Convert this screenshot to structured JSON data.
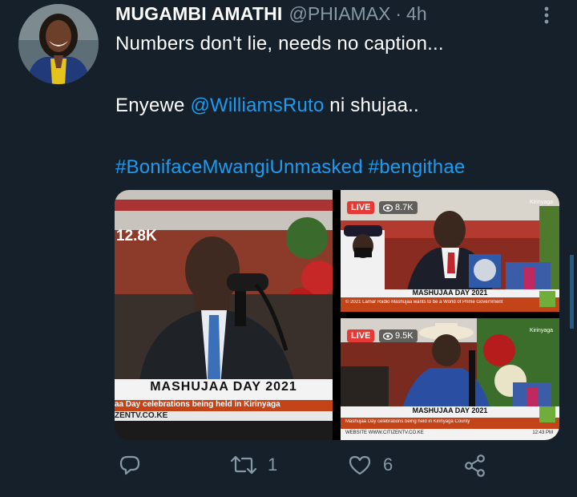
{
  "tweet": {
    "author_name": "MUGAMBI AMATHI",
    "author_handle": "@PHIAMAX",
    "separator": "·",
    "time": "4h",
    "text_line1": "Numbers don't lie, needs no caption...",
    "text_line2_prefix": "Enyewe ",
    "text_line2_mention": "@WilliamsRuto",
    "text_line2_suffix": " ni shujaa..",
    "hashtag1": "#BonifaceMwangiUnmasked",
    "hashtag2": "#bengithae"
  },
  "media": {
    "photo1": {
      "view_count": "12.8K",
      "banner_title": "MASHUJAA DAY 2021",
      "ticker": "aa Day celebrations being held in Kirinyaga",
      "url": "ZENTV.CO.KE"
    },
    "photo2": {
      "live": "LIVE",
      "views": "8.7K",
      "banner_title": "MASHUJAA DAY 2021",
      "ticker": "© 2021 Lamar Radio Mashujaa wants to be a World of Prime Government",
      "channel": "Kirinyaga"
    },
    "photo3": {
      "live": "LIVE",
      "views": "9.5K",
      "banner_title": "MASHUJAA DAY 2021",
      "ticker": "Mashujaa Day celebrations being held in Kirinyaga County",
      "website_label": "WEBSITE",
      "website": "WWW.CITIZENTV.CO.KE",
      "clock": "12:43 PM",
      "channel": "Kirinyaga"
    }
  },
  "actions": {
    "reply_count": "",
    "retweet_count": "1",
    "like_count": "6"
  },
  "colors": {
    "background": "#15202b",
    "link": "#1d9bf0",
    "muted": "#8899a6"
  },
  "icons": [
    "more-options-icon",
    "reply-icon",
    "retweet-icon",
    "like-icon",
    "share-icon",
    "eye-icon"
  ]
}
